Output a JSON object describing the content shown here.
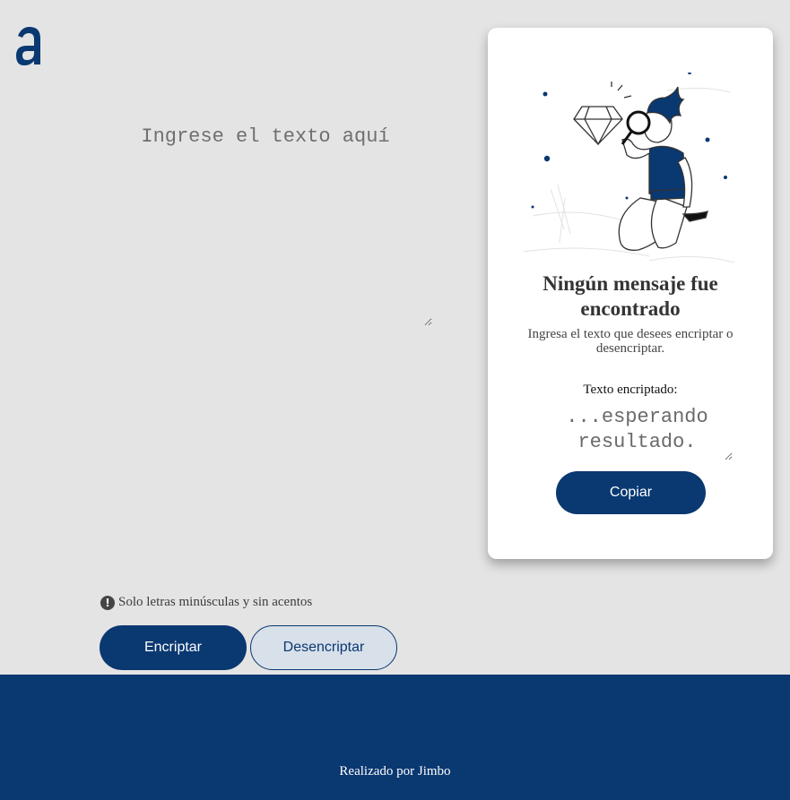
{
  "logo": {
    "icon": "alura-logo-icon",
    "color": "#0a3871"
  },
  "input": {
    "placeholder": "Ingrese el texto aquí",
    "value": ""
  },
  "notice": {
    "icon": "exclamation-circle-icon",
    "text": "Solo letras minúsculas y sin acentos"
  },
  "buttons": {
    "encrypt": "Encriptar",
    "decrypt": "Desencriptar"
  },
  "panel": {
    "illustration": "person-with-magnifier-illustration",
    "title": "Ningún mensaje fue encontrado",
    "subtitle": "Ingresa el texto que desees encriptar o desencriptar.",
    "output_label": "Texto encriptado:",
    "output_placeholder": "...esperando resultado.",
    "copy_label": "Copiar"
  },
  "footer": {
    "text": "Realizado por Jimbo"
  },
  "colors": {
    "primary": "#0a3871",
    "background": "#e4e4e4",
    "secondary_button": "#d8e0ea"
  }
}
